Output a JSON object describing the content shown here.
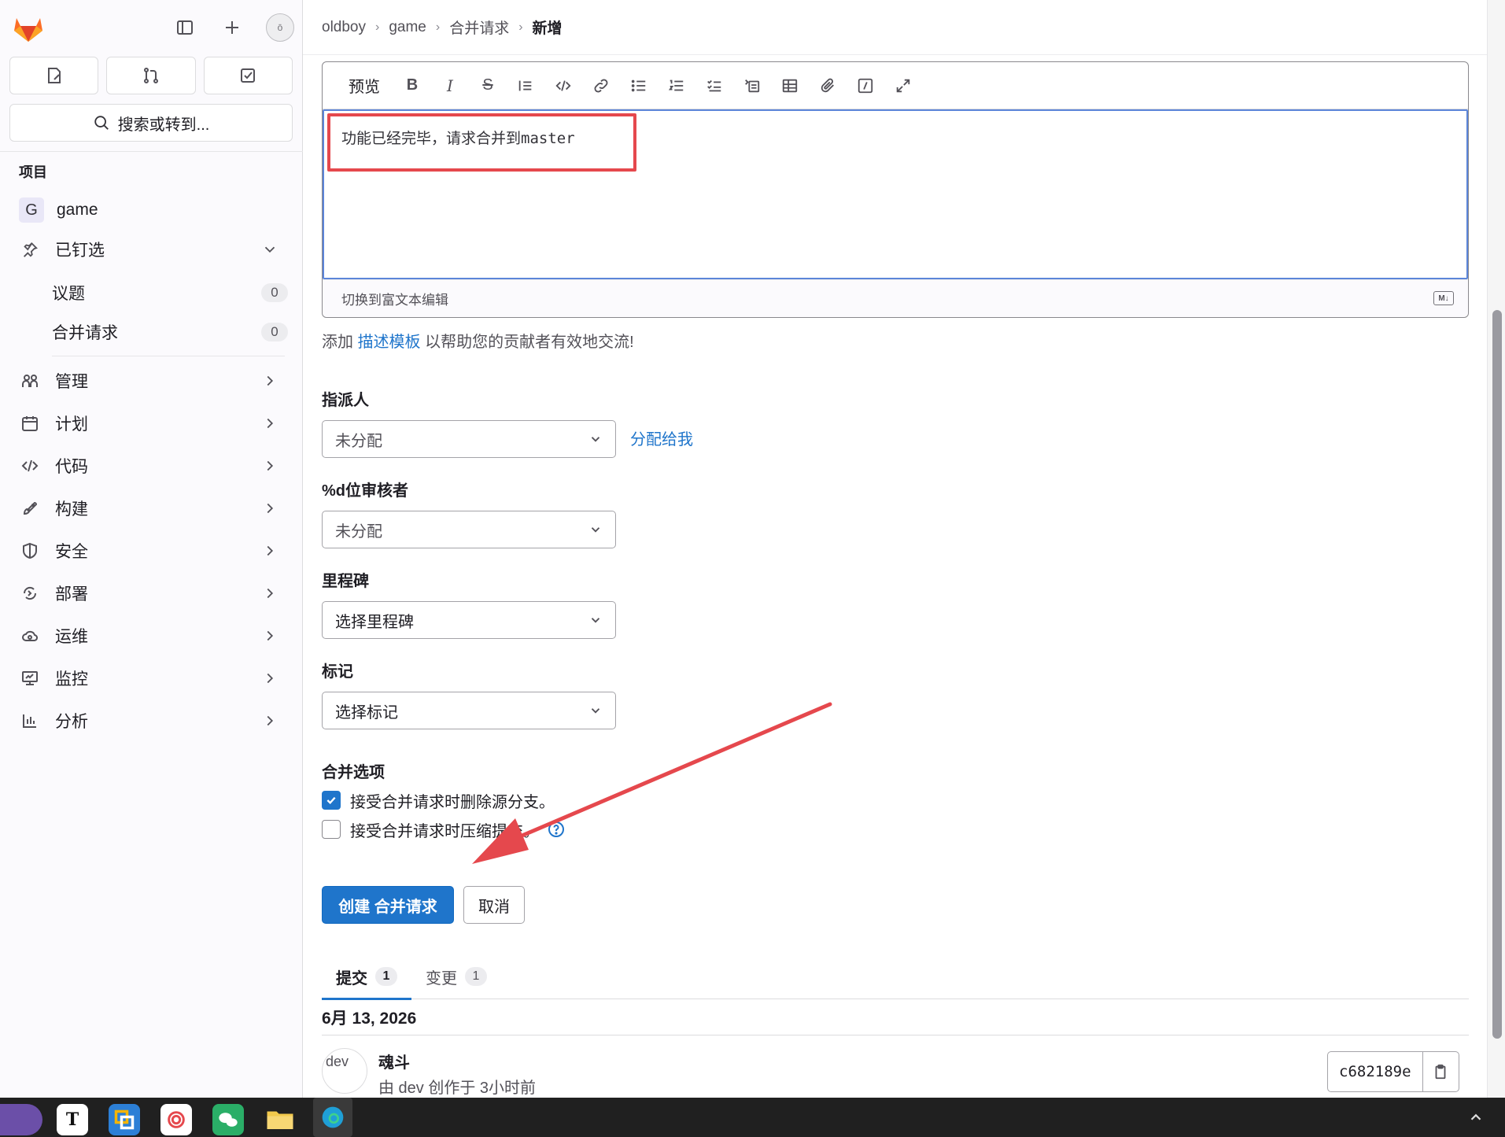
{
  "breadcrumb": [
    "oldboy",
    "game",
    "合并请求"
  ],
  "breadcrumb_current": "新增",
  "sidebar": {
    "avatar_alt": "ō",
    "search_label": "搜索或转到...",
    "section_title": "项目",
    "project": {
      "badge": "G",
      "name": "game"
    },
    "pinned": {
      "label": "已钉选"
    },
    "pinned_items": [
      {
        "label": "议题",
        "count": "0"
      },
      {
        "label": "合并请求",
        "count": "0"
      }
    ],
    "nav": [
      {
        "label": "管理",
        "icon": "users-icon"
      },
      {
        "label": "计划",
        "icon": "calendar-icon"
      },
      {
        "label": "代码",
        "icon": "code-icon"
      },
      {
        "label": "构建",
        "icon": "rocket-icon"
      },
      {
        "label": "安全",
        "icon": "shield-icon"
      },
      {
        "label": "部署",
        "icon": "deploy-icon"
      },
      {
        "label": "运维",
        "icon": "cloud-icon"
      },
      {
        "label": "监控",
        "icon": "monitor-icon"
      },
      {
        "label": "分析",
        "icon": "chart-icon"
      }
    ]
  },
  "editor": {
    "preview_label": "预览",
    "content": "功能已经完毕，请求合并到master",
    "switch_label": "切换到富文本编辑",
    "md_badge": "M↓"
  },
  "helper": {
    "prefix": "添加",
    "link": "描述模板",
    "suffix": "以帮助您的贡献者有效地交流!"
  },
  "form": {
    "assignee_label": "指派人",
    "assignee_value": "未分配",
    "assign_me": "分配给我",
    "reviewer_label": "%d位审核者",
    "reviewer_value": "未分配",
    "milestone_label": "里程碑",
    "milestone_value": "选择里程碑",
    "labels_label": "标记",
    "labels_value": "选择标记",
    "merge_options_label": "合并选项",
    "option_delete_branch": "接受合并请求时删除源分支。",
    "option_delete_branch_checked": true,
    "option_squash": "接受合并请求时压缩提交。",
    "option_squash_checked": false,
    "submit": "创建 合并请求",
    "cancel": "取消"
  },
  "tabs": [
    {
      "label": "提交",
      "count": "1",
      "active": true
    },
    {
      "label": "变更",
      "count": "1",
      "active": false
    }
  ],
  "commits": {
    "date": "6月 13, 2026",
    "avatar_alt": "dev",
    "title": "魂斗",
    "meta": "由 dev 创作于 3小时前",
    "sha": "c682189e"
  },
  "colors": {
    "accent": "#1f75cb",
    "annotation_red": "#e5484d",
    "focus_border": "#5c85d9"
  }
}
